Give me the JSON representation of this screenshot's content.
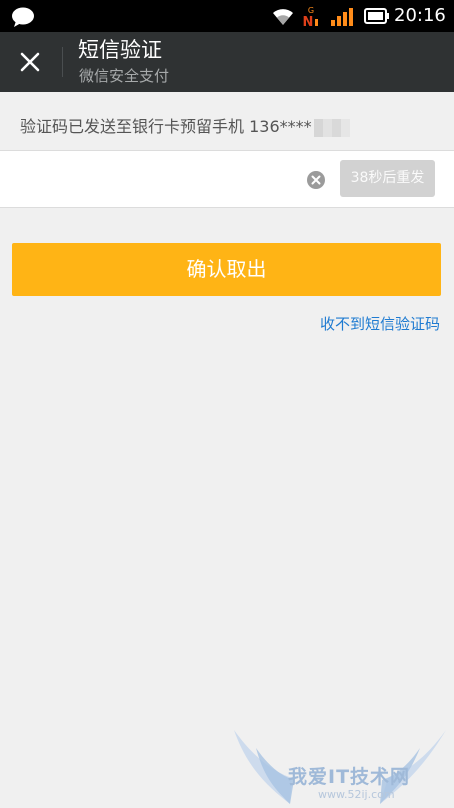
{
  "status_bar": {
    "time": "20:16",
    "icons": [
      "chat-bubble-icon",
      "wifi-icon",
      "sim-roaming-icon",
      "signal-icon",
      "battery-icon"
    ]
  },
  "header": {
    "title": "短信验证",
    "subtitle": "微信安全支付",
    "close_icon": "close-icon"
  },
  "notice": {
    "text": "验证码已发送至银行卡预留手机 136****"
  },
  "code_input": {
    "value": "",
    "placeholder": ""
  },
  "resend": {
    "label": "38秒后重发"
  },
  "confirm": {
    "label": "确认取出"
  },
  "no_sms_link": {
    "label": "收不到短信验证码"
  },
  "watermark": {
    "text": "我爱IT技术网",
    "url": "www.52ij.com"
  },
  "colors": {
    "status_bar": "#000000",
    "title_bar": "#2f3233",
    "background": "#f0f0f0",
    "accent": "#ffb415",
    "link": "#1f7bd1",
    "resend_disabled": "#d2d2d2"
  }
}
